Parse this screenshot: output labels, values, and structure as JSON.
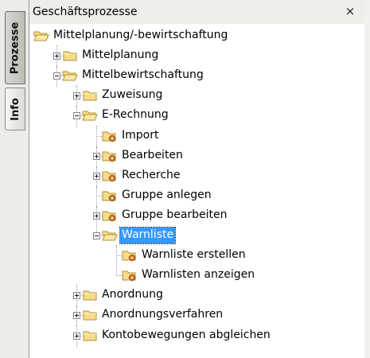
{
  "side_tabs": [
    {
      "label": "Prozesse",
      "active": true
    },
    {
      "label": "Info",
      "active": false
    }
  ],
  "panel": {
    "title": "Geschäftsprozesse",
    "close_symbol": "×"
  },
  "tree": {
    "nodes": [
      {
        "label": "Mittelplanung/-bewirtschaftung",
        "level": 0,
        "expander": "none",
        "icon": "folder-open-icon",
        "last_child": true
      },
      {
        "label": "Mittelplanung",
        "level": 1,
        "expander": "plus",
        "icon": "folder-closed-icon"
      },
      {
        "label": "Mittelbewirtschaftung",
        "level": 1,
        "expander": "minus",
        "icon": "folder-open-icon"
      },
      {
        "label": "Zuweisung",
        "level": 2,
        "expander": "plus",
        "icon": "folder-closed-icon"
      },
      {
        "label": "E-Rechnung",
        "level": 2,
        "expander": "minus",
        "icon": "folder-open-icon"
      },
      {
        "label": "Import",
        "level": 3,
        "expander": "none",
        "icon": "process-folder-icon"
      },
      {
        "label": "Bearbeiten",
        "level": 3,
        "expander": "plus",
        "icon": "process-folder-icon"
      },
      {
        "label": "Recherche",
        "level": 3,
        "expander": "plus",
        "icon": "process-folder-icon"
      },
      {
        "label": "Gruppe anlegen",
        "level": 3,
        "expander": "none",
        "icon": "process-folder-icon"
      },
      {
        "label": "Gruppe bearbeiten",
        "level": 3,
        "expander": "plus",
        "icon": "process-folder-icon"
      },
      {
        "label": "Warnliste",
        "level": 3,
        "expander": "minus",
        "icon": "folder-open-icon",
        "selected": true
      },
      {
        "label": "Warnliste erstellen",
        "level": 4,
        "expander": "none",
        "icon": "process-folder-icon"
      },
      {
        "label": "Warnlisten anzeigen",
        "level": 4,
        "expander": "none",
        "icon": "process-folder-icon"
      },
      {
        "label": "Anordnung",
        "level": 2,
        "expander": "plus",
        "icon": "folder-closed-icon"
      },
      {
        "label": "Anordnungsverfahren",
        "level": 2,
        "expander": "plus",
        "icon": "folder-closed-icon"
      },
      {
        "label": "Kontobewegungen abgleichen",
        "level": 2,
        "expander": "plus",
        "icon": "folder-closed-icon"
      }
    ]
  },
  "colors": {
    "selection": "#3399ff",
    "folder_fill": "#f4dc8c",
    "folder_stroke": "#b8912e",
    "gear": "#e07a1f"
  }
}
